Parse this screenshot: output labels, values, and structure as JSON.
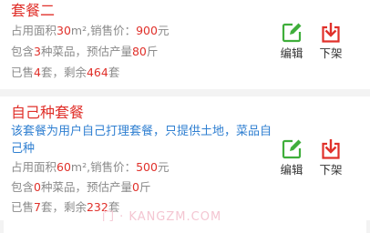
{
  "packages": [
    {
      "name": "套餐二",
      "area_label": "占用面积",
      "area_value": "30",
      "area_unit": "m²",
      "price_label": ",销售价：",
      "price_value": "900",
      "price_unit": "元",
      "contains_label": "包含",
      "dish_count": "3",
      "dish_unit": "种菜品，预估产量",
      "yield_value": "80",
      "yield_unit": "斤",
      "sold_label": "已售",
      "sold_value": "4",
      "remain_label": "套，剩余",
      "remain_value": "464",
      "remain_unit": "套",
      "edit_label": "编辑",
      "offline_label": "下架"
    },
    {
      "name": "自己种套餐",
      "description": "该套餐为用户自己打理套餐，只提供土地，菜品自己种",
      "area_label": "占用面积",
      "area_value": "60",
      "area_unit": "m²",
      "price_label": ",销售价：",
      "price_value": "500",
      "price_unit": "元",
      "contains_label": "包含",
      "dish_count": "0",
      "dish_unit": "种菜品，预估产量",
      "yield_value": "0",
      "yield_unit": "斤",
      "sold_label": "已售",
      "sold_value": "7",
      "remain_label": "套，剩余",
      "remain_value": "232",
      "remain_unit": "套",
      "edit_label": "编辑",
      "offline_label": "下架"
    }
  ],
  "watermark": "门 · KANGZM.COM",
  "colors": {
    "accent_red": "#e0302a",
    "edit_green": "#3fae3b",
    "desc_blue": "#2f7fd1"
  },
  "icons": {
    "edit": "edit-icon",
    "offline": "download-icon"
  }
}
